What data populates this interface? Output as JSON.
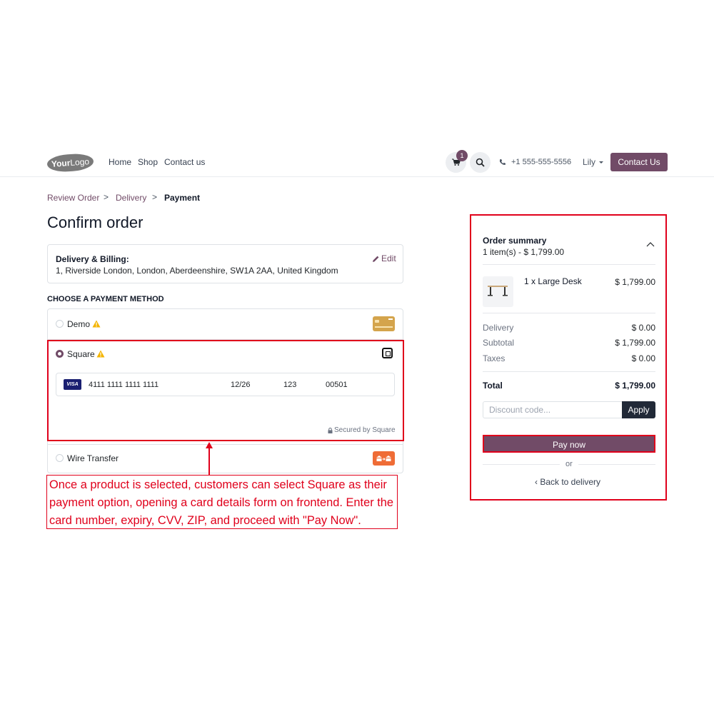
{
  "header": {
    "logo_text_bold": "Your",
    "logo_text": "Logo",
    "nav": [
      "Home",
      "Shop",
      "Contact us"
    ],
    "cart_count": "1",
    "phone": "+1 555-555-5556",
    "user": "Lily",
    "contact_button": "Contact Us"
  },
  "breadcrumb": {
    "step1": "Review Order",
    "step2": "Delivery",
    "step3": "Payment",
    "separator": ">"
  },
  "page_title": "Confirm order",
  "address": {
    "title": "Delivery & Billing:",
    "text": "1, Riverside London, London, Aberdeenshire, SW1A 2AA, United Kingdom",
    "edit_label": "Edit"
  },
  "payment": {
    "heading": "CHOOSE A PAYMENT METHOD",
    "methods": [
      {
        "label": "Demo",
        "selected": false,
        "icon": "credit-card-icon"
      },
      {
        "label": "Square",
        "selected": true,
        "icon": "square-logo-icon"
      },
      {
        "label": "Wire Transfer",
        "selected": false,
        "icon": "bank-transfer-icon"
      }
    ],
    "card": {
      "brand": "VISA",
      "number": "4111 1111 1111 1111",
      "expiry": "12/26",
      "cvv": "123",
      "zip": "00501"
    },
    "secured_text": "Secured by Square"
  },
  "annotation": {
    "text": "Once a product is selected, customers can select Square as their payment option, opening a card details form on frontend. Enter the card number, expiry, CVV, ZIP, and proceed with \"Pay Now\"."
  },
  "summary": {
    "title": "Order summary",
    "count": "1 item(s) -  $ 1,799.00",
    "product": {
      "name": "1 x Large Desk",
      "price": "$ 1,799.00"
    },
    "lines": [
      {
        "label": "Delivery",
        "value": "$ 0.00"
      },
      {
        "label": "Subtotal",
        "value": "$ 1,799.00"
      },
      {
        "label": "Taxes",
        "value": "$ 0.00"
      }
    ],
    "total_label": "Total",
    "total_value": "$ 1,799.00",
    "discount_placeholder": "Discount code...",
    "apply_label": "Apply",
    "pay_label": "Pay now",
    "or_text": "or",
    "back_label": "‹  Back to delivery"
  },
  "colors": {
    "brand": "#714B67",
    "annotation_red": "#e0001b",
    "dark_button": "#212937"
  }
}
